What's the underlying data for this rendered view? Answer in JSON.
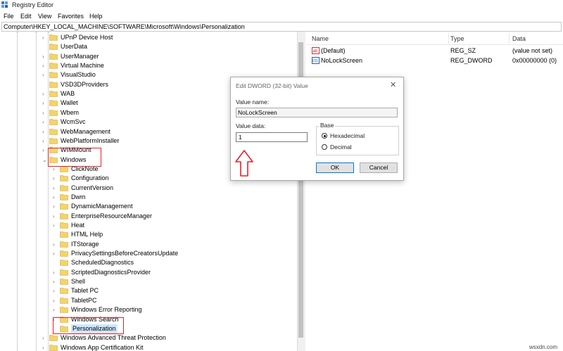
{
  "window": {
    "title": "Registry Editor"
  },
  "menu": [
    "File",
    "Edit",
    "View",
    "Favorites",
    "Help"
  ],
  "address": "Computer\\HKEY_LOCAL_MACHINE\\SOFTWARE\\Microsoft\\Windows\\Personalization",
  "tree": [
    {
      "label": "UPnP Device Host",
      "level": 1,
      "expander": "right"
    },
    {
      "label": "UserData",
      "level": 1,
      "expander": "none"
    },
    {
      "label": "UserManager",
      "level": 1,
      "expander": "right"
    },
    {
      "label": "Virtual Machine",
      "level": 1,
      "expander": "right"
    },
    {
      "label": "VisualStudio",
      "level": 1,
      "expander": "right"
    },
    {
      "label": "VSD3DProviders",
      "level": 1,
      "expander": "none"
    },
    {
      "label": "WAB",
      "level": 1,
      "expander": "right"
    },
    {
      "label": "Wallet",
      "level": 1,
      "expander": "right"
    },
    {
      "label": "Wbem",
      "level": 1,
      "expander": "right"
    },
    {
      "label": "WcmSvc",
      "level": 1,
      "expander": "right"
    },
    {
      "label": "WebManagement",
      "level": 1,
      "expander": "right"
    },
    {
      "label": "WebPlatformInstaller",
      "level": 1,
      "expander": "right"
    },
    {
      "label": "WIMMount",
      "level": 1,
      "expander": "right"
    },
    {
      "label": "Windows",
      "level": 1,
      "expander": "down"
    },
    {
      "label": "ClickNote",
      "level": 2,
      "expander": "right"
    },
    {
      "label": "Configuration",
      "level": 2,
      "expander": "right"
    },
    {
      "label": "CurrentVersion",
      "level": 2,
      "expander": "right"
    },
    {
      "label": "Dwm",
      "level": 2,
      "expander": "right"
    },
    {
      "label": "DynamicManagement",
      "level": 2,
      "expander": "right"
    },
    {
      "label": "EnterpriseResourceManager",
      "level": 2,
      "expander": "right"
    },
    {
      "label": "Heat",
      "level": 2,
      "expander": "right"
    },
    {
      "label": "HTML Help",
      "level": 2,
      "expander": "none"
    },
    {
      "label": "ITStorage",
      "level": 2,
      "expander": "right"
    },
    {
      "label": "PrivacySettingsBeforeCreatorsUpdate",
      "level": 2,
      "expander": "right"
    },
    {
      "label": "ScheduledDiagnostics",
      "level": 2,
      "expander": "none"
    },
    {
      "label": "ScriptedDiagnosticsProvider",
      "level": 2,
      "expander": "right"
    },
    {
      "label": "Shell",
      "level": 2,
      "expander": "right"
    },
    {
      "label": "Tablet PC",
      "level": 2,
      "expander": "right"
    },
    {
      "label": "TabletPC",
      "level": 2,
      "expander": "right"
    },
    {
      "label": "Windows Error Reporting",
      "level": 2,
      "expander": "right"
    },
    {
      "label": "Windows Search",
      "level": 2,
      "expander": "right"
    },
    {
      "label": "Personalization",
      "level": 2,
      "expander": "none",
      "selected": true
    },
    {
      "label": "Windows Advanced Threat Protection",
      "level": 1,
      "expander": "right"
    },
    {
      "label": "Windows App Certification Kit",
      "level": 1,
      "expander": "right"
    }
  ],
  "list": {
    "columns": [
      "Name",
      "Type",
      "Data"
    ],
    "rows": [
      {
        "icon": "string-value-icon",
        "name": "(Default)",
        "type": "REG_SZ",
        "data": "(value not set)"
      },
      {
        "icon": "dword-value-icon",
        "name": "NoLockScreen",
        "type": "REG_DWORD",
        "data": "0x00000000 (0)"
      }
    ]
  },
  "dialog": {
    "title": "Edit DWORD (32-bit) Value",
    "value_name_label": "Value name:",
    "value_name": "NoLockScreen",
    "value_data_label": "Value data:",
    "value_data": "1",
    "base_label": "Base",
    "hex_label": "Hexadecimal",
    "dec_label": "Decimal",
    "selected_base": "Hexadecimal",
    "ok_label": "OK",
    "cancel_label": "Cancel",
    "close_glyph": "✕"
  },
  "colors": {
    "annotation": "#e8202a",
    "folder": "#f3d36b",
    "selection": "#cce8ff"
  },
  "watermark": "wsxdn.com"
}
